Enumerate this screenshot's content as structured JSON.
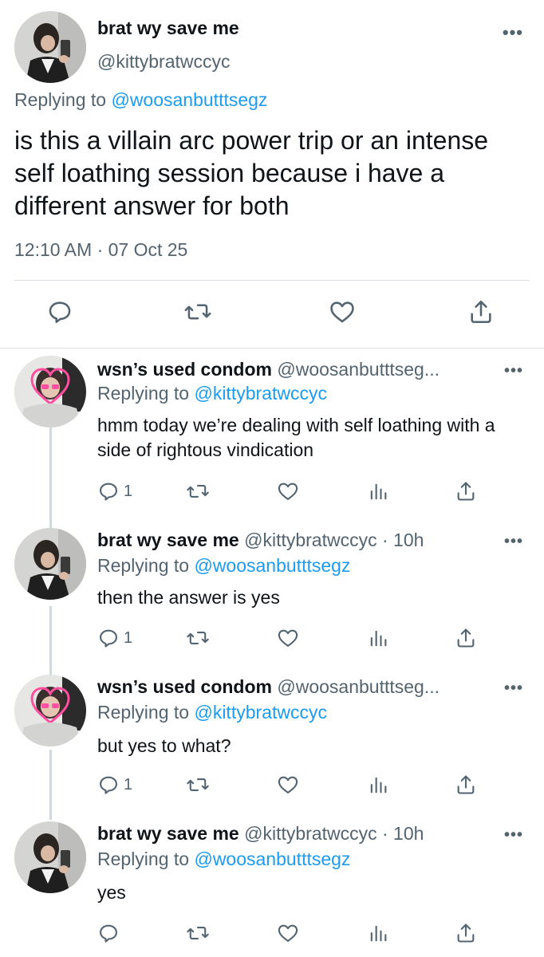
{
  "main_tweet": {
    "display_name": "brat wy save me",
    "handle": "@kittybratwccyc",
    "replying_prefix": "Replying to",
    "replying_to": "@woosanbutttsegz",
    "text": "is this a villain arc power trip or an intense self loathing session because i have a different answer for both",
    "timestamp": "12:10 AM · 07 Oct 25",
    "more": "•••"
  },
  "replies": [
    {
      "display_name": "wsn’s used condom",
      "handle": "@woosanbutttseg...",
      "meta": "",
      "replying_prefix": "Replying to",
      "replying_to": "@kittybratwccyc",
      "text": "hmm today we’re dealing with self loathing with a side of rightous vindication",
      "reply_count": "1",
      "more": "•••",
      "avatar": "pink-heart-avatar"
    },
    {
      "display_name": "brat wy save me",
      "handle": "@kittybratwccyc",
      "meta": " · 10h",
      "replying_prefix": "Replying to",
      "replying_to": "@woosanbutttsegz",
      "text": "then the answer is yes",
      "reply_count": "1",
      "more": "•••",
      "avatar": "mirror-selfie-avatar"
    },
    {
      "display_name": "wsn’s used condom",
      "handle": "@woosanbutttseg...",
      "meta": "",
      "replying_prefix": "Replying to",
      "replying_to": "@kittybratwccyc",
      "text": "but yes to what?",
      "reply_count": "1",
      "more": "•••",
      "avatar": "pink-heart-avatar"
    },
    {
      "display_name": "brat wy save me",
      "handle": "@kittybratwccyc",
      "meta": " · 10h",
      "replying_prefix": "Replying to",
      "replying_to": "@woosanbutttsegz",
      "text": "yes",
      "reply_count": "",
      "more": "•••",
      "avatar": "mirror-selfie-avatar"
    }
  ],
  "icons": [
    "reply-icon",
    "retweet-icon",
    "like-icon",
    "views-icon",
    "share-icon",
    "more-icon"
  ],
  "colors": {
    "link": "#1d9bf0",
    "secondary": "#536471",
    "text": "#0f1419",
    "divider": "#d9dde1"
  }
}
